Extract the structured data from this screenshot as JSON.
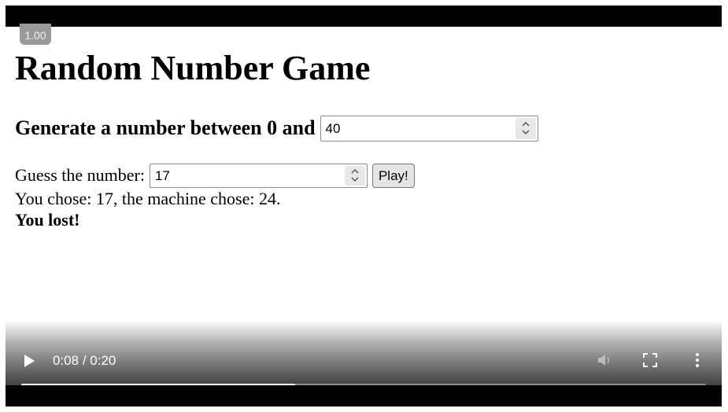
{
  "player": {
    "speed": "1.00",
    "time_current": "0:08",
    "time_separator": " / ",
    "time_total": "0:20",
    "progress": 0.4
  },
  "page": {
    "title": "Random Number Game",
    "generate_label": "Generate a number between 0 and",
    "max_value": "40",
    "guess_label": "Guess the number:",
    "guess_value": "17",
    "play_label": "Play!",
    "result_text": "You chose: 17, the machine chose: 24.",
    "outcome_text": "You lost!"
  },
  "icons": {
    "play": "play-icon",
    "volume": "volume-muted-icon",
    "fullscreen": "fullscreen-icon",
    "more": "more-options-icon",
    "spin_arrows": "spinner-arrows-icon"
  },
  "colors": {
    "letterbox": "#000000",
    "badge": "#9a9a9a",
    "progress_fill": "#ffffff",
    "progress_track": "#8f8f8f"
  }
}
